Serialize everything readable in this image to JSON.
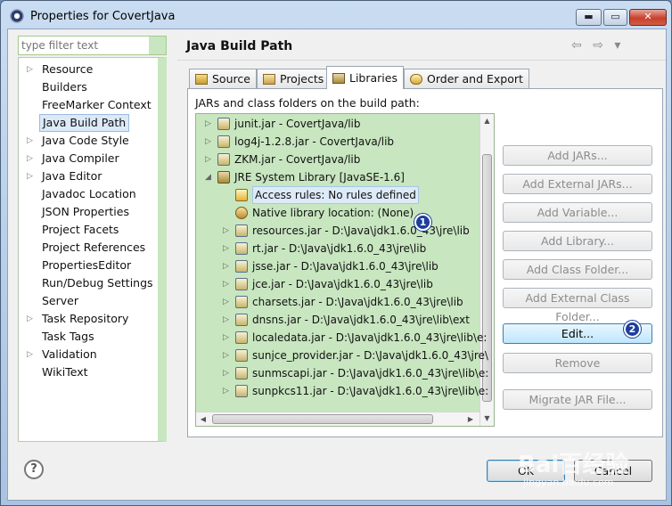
{
  "window": {
    "title": "Properties for CovertJava",
    "minimize": "▬",
    "maximize": "▭",
    "close": "✕"
  },
  "filter": {
    "placeholder": "type filter text"
  },
  "nav": {
    "items": [
      {
        "label": "Resource",
        "expandable": true,
        "selected": false
      },
      {
        "label": "Builders",
        "expandable": false,
        "selected": false
      },
      {
        "label": "FreeMarker Context",
        "expandable": false,
        "selected": false
      },
      {
        "label": "Java Build Path",
        "expandable": false,
        "selected": true
      },
      {
        "label": "Java Code Style",
        "expandable": true,
        "selected": false
      },
      {
        "label": "Java Compiler",
        "expandable": true,
        "selected": false
      },
      {
        "label": "Java Editor",
        "expandable": true,
        "selected": false
      },
      {
        "label": "Javadoc Location",
        "expandable": false,
        "selected": false
      },
      {
        "label": "JSON Properties",
        "expandable": false,
        "selected": false
      },
      {
        "label": "Project Facets",
        "expandable": false,
        "selected": false
      },
      {
        "label": "Project References",
        "expandable": false,
        "selected": false
      },
      {
        "label": "PropertiesEditor",
        "expandable": false,
        "selected": false
      },
      {
        "label": "Run/Debug Settings",
        "expandable": false,
        "selected": false
      },
      {
        "label": "Server",
        "expandable": false,
        "selected": false
      },
      {
        "label": "Task Repository",
        "expandable": true,
        "selected": false
      },
      {
        "label": "Task Tags",
        "expandable": false,
        "selected": false
      },
      {
        "label": "Validation",
        "expandable": true,
        "selected": false
      },
      {
        "label": "WikiText",
        "expandable": false,
        "selected": false
      }
    ]
  },
  "page": {
    "title": "Java Build Path",
    "back_arrow": "⇦",
    "forward_arrow": "⇨",
    "menu_arrow": "▾"
  },
  "tabs": [
    {
      "label": "Source",
      "active": false
    },
    {
      "label": "Projects",
      "active": false
    },
    {
      "label": "Libraries",
      "active": true
    },
    {
      "label": "Order and Export",
      "active": false
    }
  ],
  "libraries": {
    "caption": "JARs and class folders on the build path:",
    "tree": [
      {
        "label": "junit.jar - CovertJava/lib",
        "level": 0,
        "expander": "▷",
        "icon": "jar"
      },
      {
        "label": "log4j-1.2.8.jar - CovertJava/lib",
        "level": 0,
        "expander": "▷",
        "icon": "jar"
      },
      {
        "label": "ZKM.jar - CovertJava/lib",
        "level": 0,
        "expander": "▷",
        "icon": "jar"
      },
      {
        "label": "JRE System Library [JavaSE-1.6]",
        "level": 0,
        "expander": "◢",
        "icon": "lib"
      },
      {
        "label": "Access rules: No rules defined",
        "level": 1,
        "expander": "",
        "icon": "rule",
        "highlight": true
      },
      {
        "label": "Native library location: (None)",
        "level": 1,
        "expander": "",
        "icon": "native"
      },
      {
        "label": "resources.jar - D:\\Java\\jdk1.6.0_43\\jre\\lib",
        "level": 1,
        "expander": "▷",
        "icon": "jar"
      },
      {
        "label": "rt.jar - D:\\Java\\jdk1.6.0_43\\jre\\lib",
        "level": 1,
        "expander": "▷",
        "icon": "jar"
      },
      {
        "label": "jsse.jar - D:\\Java\\jdk1.6.0_43\\jre\\lib",
        "level": 1,
        "expander": "▷",
        "icon": "jar"
      },
      {
        "label": "jce.jar - D:\\Java\\jdk1.6.0_43\\jre\\lib",
        "level": 1,
        "expander": "▷",
        "icon": "jar"
      },
      {
        "label": "charsets.jar - D:\\Java\\jdk1.6.0_43\\jre\\lib",
        "level": 1,
        "expander": "▷",
        "icon": "jar"
      },
      {
        "label": "dnsns.jar - D:\\Java\\jdk1.6.0_43\\jre\\lib\\ext",
        "level": 1,
        "expander": "▷",
        "icon": "jar"
      },
      {
        "label": "localedata.jar - D:\\Java\\jdk1.6.0_43\\jre\\lib\\e:",
        "level": 1,
        "expander": "▷",
        "icon": "jar"
      },
      {
        "label": "sunjce_provider.jar - D:\\Java\\jdk1.6.0_43\\jre\\",
        "level": 1,
        "expander": "▷",
        "icon": "jar"
      },
      {
        "label": "sunmscapi.jar - D:\\Java\\jdk1.6.0_43\\jre\\lib\\e:",
        "level": 1,
        "expander": "▷",
        "icon": "jar"
      },
      {
        "label": "sunpkcs11.jar - D:\\Java\\jdk1.6.0_43\\jre\\lib\\e:",
        "level": 1,
        "expander": "▷",
        "icon": "jar"
      }
    ],
    "buttons": [
      {
        "label": "Add JARs...",
        "enabled": false
      },
      {
        "label": "Add External JARs...",
        "enabled": false
      },
      {
        "label": "Add Variable...",
        "enabled": false
      },
      {
        "label": "Add Library...",
        "enabled": false
      },
      {
        "label": "Add Class Folder...",
        "enabled": false
      },
      {
        "label": "Add External Class Folder...",
        "enabled": false
      },
      {
        "label": "Edit...",
        "enabled": true
      },
      {
        "label": "Remove",
        "enabled": false
      },
      {
        "label": "Migrate JAR File...",
        "enabled": false
      }
    ],
    "badges": [
      "1",
      "2"
    ]
  },
  "footer": {
    "help": "?",
    "ok": "OK",
    "cancel": "Cancel"
  },
  "watermark": {
    "logo": "Bai百经验",
    "url": "jingyan.baidu.com"
  }
}
